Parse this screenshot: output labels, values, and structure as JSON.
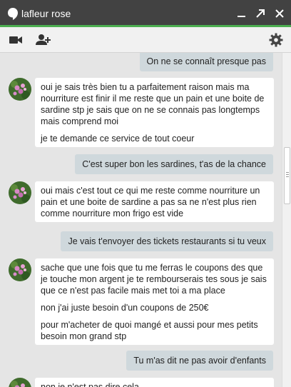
{
  "window": {
    "title": "lafleur rose"
  },
  "messages": {
    "out_1": "On ne se connaît presque pas",
    "in_1": {
      "paragraphs": [
        "oui je sais très bien tu a parfaitement raison mais ma nourriture est finir il me reste que un pain et une boite de sardine stp je sais que on ne se connais pas longtemps mais comprend moi",
        "je te demande ce service de tout coeur"
      ]
    },
    "out_2": "C'est super bon les sardines, t'as de la chance",
    "in_2": {
      "paragraphs": [
        "oui mais c'est tout ce qui me reste comme nourriture un pain et une boite de sardine a pas sa ne n'est plus rien comme nourriture mon frigo est vide"
      ]
    },
    "out_3": "Je vais t'envoyer des tickets restaurants si tu veux",
    "in_3": {
      "paragraphs": [
        "sache que une fois que tu me ferras le coupons des que je touche mon argent je te rembourserais tes sous je sais que ce n'est pas facile mais met toi a ma place",
        "non j'ai juste besoin d'un coupons de 250€",
        "pour m'acheter de quoi mangé et aussi pour mes petits besoin mon grand stp"
      ]
    },
    "out_4": "Tu m'as dit ne pas avoir d'enfants",
    "in_4": {
      "paragraphs": [
        "non je n'est pas dire cela"
      ]
    }
  },
  "colors": {
    "titlebar": "#424242",
    "accent": "#4caf50",
    "toolbar": "#f1f1f1",
    "chat_background": "#e5e5e5",
    "outgoing_bubble": "#cfd8dc",
    "incoming_bubble": "#ffffff"
  },
  "icons": {
    "title": "hangouts-bubble-icon",
    "minimize": "minimize-icon",
    "popout": "pop-out-arrow-icon",
    "close": "close-icon",
    "video": "video-camera-icon",
    "add_person": "add-person-icon",
    "settings": "gear-icon",
    "avatar": "rose-photo-avatar"
  }
}
